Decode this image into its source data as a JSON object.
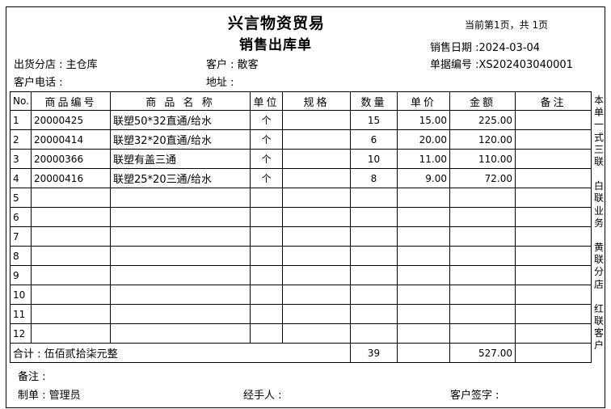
{
  "header": {
    "company": "兴言物资贸易",
    "doc_title": "销售出库单",
    "page_info": "当前第1页，共 1页"
  },
  "info": {
    "sale_date": "销售日期 :2024-03-04",
    "warehouse": "出货分店 : 主仓库",
    "customer": "客户 : 散客",
    "doc_no": "单据编号 :XS202403040001",
    "phone": "客户电话 :",
    "address": "地址 :"
  },
  "table": {
    "headers": [
      "No.",
      "商品编号",
      "商 品 名 称",
      "单位",
      "规格",
      "数量",
      "单价",
      "金额",
      "备注"
    ],
    "rows": [
      {
        "no": "1",
        "code": "20000425",
        "name": "联塑50*32直通/给水",
        "unit": "个",
        "spec": "",
        "qty": "15",
        "price": "15.00",
        "amount": "225.00",
        "note": ""
      },
      {
        "no": "2",
        "code": "20000414",
        "name": "联塑32*20直通/给水",
        "unit": "个",
        "spec": "",
        "qty": "6",
        "price": "20.00",
        "amount": "120.00",
        "note": ""
      },
      {
        "no": "3",
        "code": "20000366",
        "name": "联塑有盖三通",
        "unit": "个",
        "spec": "",
        "qty": "10",
        "price": "11.00",
        "amount": "110.00",
        "note": ""
      },
      {
        "no": "4",
        "code": "20000416",
        "name": "联塑25*20三通/给水",
        "unit": "个",
        "spec": "",
        "qty": "8",
        "price": "9.00",
        "amount": "72.00",
        "note": ""
      },
      {
        "no": "5",
        "code": "",
        "name": "",
        "unit": "",
        "spec": "",
        "qty": "",
        "price": "",
        "amount": "",
        "note": ""
      },
      {
        "no": "6",
        "code": "",
        "name": "",
        "unit": "",
        "spec": "",
        "qty": "",
        "price": "",
        "amount": "",
        "note": ""
      },
      {
        "no": "7",
        "code": "",
        "name": "",
        "unit": "",
        "spec": "",
        "qty": "",
        "price": "",
        "amount": "",
        "note": ""
      },
      {
        "no": "8",
        "code": "",
        "name": "",
        "unit": "",
        "spec": "",
        "qty": "",
        "price": "",
        "amount": "",
        "note": ""
      },
      {
        "no": "9",
        "code": "",
        "name": "",
        "unit": "",
        "spec": "",
        "qty": "",
        "price": "",
        "amount": "",
        "note": ""
      },
      {
        "no": "10",
        "code": "",
        "name": "",
        "unit": "",
        "spec": "",
        "qty": "",
        "price": "",
        "amount": "",
        "note": ""
      },
      {
        "no": "11",
        "code": "",
        "name": "",
        "unit": "",
        "spec": "",
        "qty": "",
        "price": "",
        "amount": "",
        "note": ""
      },
      {
        "no": "12",
        "code": "",
        "name": "",
        "unit": "",
        "spec": "",
        "qty": "",
        "price": "",
        "amount": "",
        "note": ""
      }
    ],
    "total": {
      "label": "合计 : 伍佰贰拾柒元整",
      "qty": "39",
      "amount": "527.00"
    }
  },
  "side_note": [
    "本单一式三联",
    "白联业务",
    "黄联分店",
    "红联客户"
  ],
  "footer": {
    "remark": "备注 :",
    "maker": "制单 : 管理员",
    "handler": "经手人 :",
    "signature": "客户签字 :"
  }
}
